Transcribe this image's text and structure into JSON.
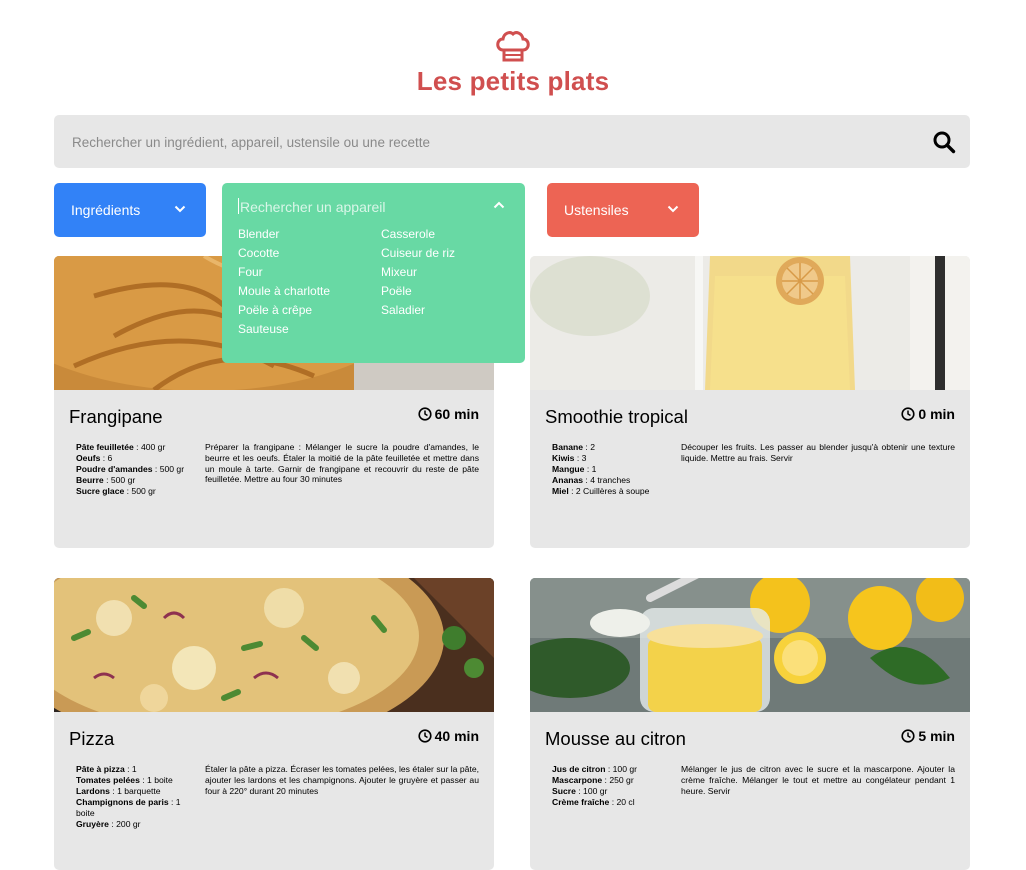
{
  "header": {
    "title": "Les petits plats",
    "logo_icon": "chef-hat-icon"
  },
  "search": {
    "placeholder": "Rechercher un ingrédient, appareil, ustensile ou une recette",
    "icon": "search-icon"
  },
  "filters": {
    "ingredients": {
      "label": "Ingrédients",
      "color": "#3282F7"
    },
    "appareils": {
      "placeholder": "Rechercher un appareil",
      "color": "#68D9A4",
      "options": [
        "Blender",
        "Casserole",
        "Cocotte",
        "Cuiseur de riz",
        "Four",
        "Mixeur",
        "Moule à charlotte",
        "Poële",
        "Poële à crêpe",
        "Saladier",
        "Sauteuse"
      ]
    },
    "ustensiles": {
      "label": "Ustensiles",
      "color": "#ED6454"
    }
  },
  "recipes": [
    {
      "name": "Frangipane",
      "time": "60 min",
      "ingredients": [
        {
          "name": "Pâte feuilletée",
          "qty": " : 400 gr"
        },
        {
          "name": "Oeufs",
          "qty": " : 6"
        },
        {
          "name": "Poudre d'amandes",
          "qty": " : 500 gr"
        },
        {
          "name": "Beurre",
          "qty": " : 500 gr"
        },
        {
          "name": "Sucre glace",
          "qty": " : 500 gr"
        }
      ],
      "description": "Préparer la frangipane : Mélanger le sucre la poudre d'amandes, le beurre et les oeufs. Étaler la moitié de la pâte feuilletée et mettre dans un moule à tarte. Garnir de frangipane et recouvrir du reste de pâte feuilletée. Mettre au four 30 minutes"
    },
    {
      "name": "Smoothie tropical",
      "time": "0 min",
      "ingredients": [
        {
          "name": "Banane",
          "qty": " : 2"
        },
        {
          "name": "Kiwis",
          "qty": " : 3"
        },
        {
          "name": "Mangue",
          "qty": " : 1"
        },
        {
          "name": "Ananas",
          "qty": " : 4 tranches"
        },
        {
          "name": "Miel",
          "qty": " : 2 Cuillères à soupe"
        }
      ],
      "description": "Découper les fruits. Les passer au blender jusqu'à obtenir une texture liquide. Mettre au frais. Servir"
    },
    {
      "name": "Pizza",
      "time": "40 min",
      "ingredients": [
        {
          "name": "Pâte à pizza",
          "qty": " : 1"
        },
        {
          "name": "Tomates pelées",
          "qty": " : 1 boite"
        },
        {
          "name": "Lardons",
          "qty": " : 1 barquette"
        },
        {
          "name": "Champignons de paris",
          "qty": " : 1 boite"
        },
        {
          "name": "Gruyère",
          "qty": " : 200 gr"
        }
      ],
      "description": "Étaler la pâte a pizza. Écraser les tomates pelées, les étaler sur la pâte, ajouter les lardons et les champignons. Ajouter le gruyère et passer au four à 220° durant 20 minutes"
    },
    {
      "name": "Mousse au citron",
      "time": "5 min",
      "ingredients": [
        {
          "name": "Jus de citron",
          "qty": " : 100 gr"
        },
        {
          "name": "Mascarpone",
          "qty": " : 250 gr"
        },
        {
          "name": "Sucre",
          "qty": " : 100 gr"
        },
        {
          "name": "Crème fraîche",
          "qty": " : 20 cl"
        }
      ],
      "description": "Mélanger le jus de citron avec le sucre et la mascarpone. Ajouter la crème fraîche. Mélanger le tout et mettre au congélateur pendant 1 heure. Servir"
    }
  ]
}
